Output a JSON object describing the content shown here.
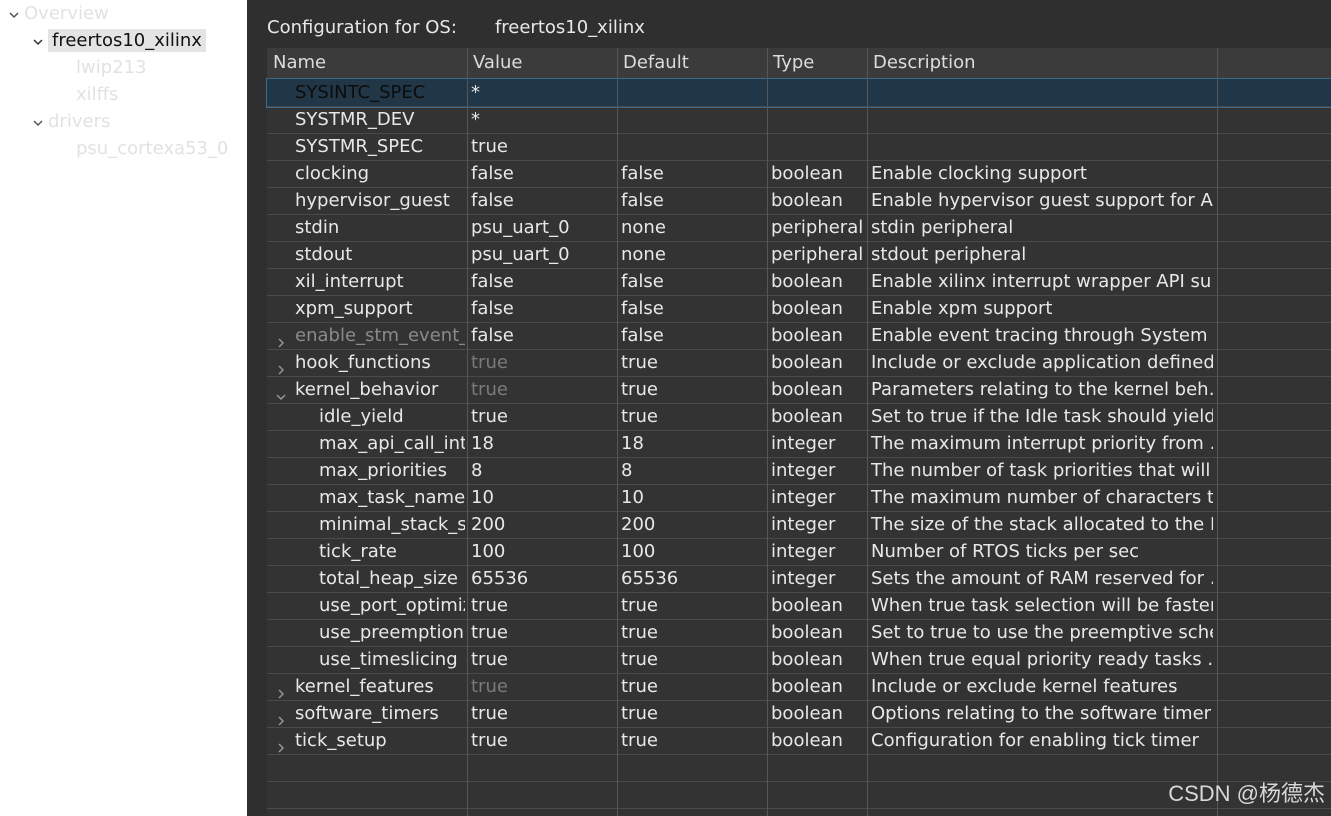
{
  "sidebar": {
    "items": [
      {
        "label": "Overview",
        "expanded": true
      },
      {
        "label": "freertos10_xilinx",
        "expanded": true,
        "selected": true
      },
      {
        "label": "lwip213"
      },
      {
        "label": "xilffs"
      },
      {
        "label": "drivers",
        "expanded": true
      },
      {
        "label": "psu_cortexa53_0"
      }
    ]
  },
  "header": {
    "label": "Configuration for OS:",
    "os_name": "freertos10_xilinx"
  },
  "table": {
    "columns": [
      "Name",
      "Value",
      "Default",
      "Type",
      "Description"
    ],
    "rows": [
      {
        "name": "SYSINTC_SPEC",
        "value": "*",
        "default": "",
        "type": "",
        "desc": "",
        "level": 0,
        "selected": true
      },
      {
        "name": "SYSTMR_DEV",
        "value": "*",
        "default": "",
        "type": "",
        "desc": "",
        "level": 0
      },
      {
        "name": "SYSTMR_SPEC",
        "value": "true",
        "default": "",
        "type": "",
        "desc": "",
        "level": 0
      },
      {
        "name": "clocking",
        "value": "false",
        "default": "false",
        "type": "boolean",
        "desc": "Enable clocking support",
        "level": 0
      },
      {
        "name": "hypervisor_guest",
        "value": "false",
        "default": "false",
        "type": "boolean",
        "desc": "Enable hypervisor guest support for A…",
        "level": 0
      },
      {
        "name": "stdin",
        "value": "psu_uart_0",
        "default": "none",
        "type": "peripheral",
        "desc": "stdin peripheral",
        "level": 0
      },
      {
        "name": "stdout",
        "value": "psu_uart_0",
        "default": "none",
        "type": "peripheral",
        "desc": "stdout peripheral",
        "level": 0
      },
      {
        "name": "xil_interrupt",
        "value": "false",
        "default": "false",
        "type": "boolean",
        "desc": "Enable xilinx interrupt wrapper API su…",
        "level": 0
      },
      {
        "name": "xpm_support",
        "value": "false",
        "default": "false",
        "type": "boolean",
        "desc": "Enable xpm support",
        "level": 0
      },
      {
        "name": "enable_stm_event_t",
        "value": "false",
        "default": "false",
        "type": "boolean",
        "desc": "Enable event tracing through System …",
        "level": 0,
        "expander": "collapsed",
        "name_dim": true
      },
      {
        "name": "hook_functions",
        "value": "true",
        "default": "true",
        "type": "boolean",
        "desc": "Include or exclude application defined…",
        "level": 0,
        "expander": "collapsed",
        "value_dim": true
      },
      {
        "name": "kernel_behavior",
        "value": "true",
        "default": "true",
        "type": "boolean",
        "desc": "Parameters relating to the kernel beh…",
        "level": 0,
        "expander": "expanded",
        "value_dim": true
      },
      {
        "name": "idle_yield",
        "value": "true",
        "default": "true",
        "type": "boolean",
        "desc": "Set to true if the Idle task should yield…",
        "level": 1
      },
      {
        "name": "max_api_call_inte",
        "value": "18",
        "default": "18",
        "type": "integer",
        "desc": "The maximum interrupt priority from …",
        "level": 1
      },
      {
        "name": "max_priorities",
        "value": "8",
        "default": "8",
        "type": "integer",
        "desc": "The number of task priorities that will …",
        "level": 1
      },
      {
        "name": "max_task_name_l",
        "value": "10",
        "default": "10",
        "type": "integer",
        "desc": "The maximum number of characters t…",
        "level": 1
      },
      {
        "name": "minimal_stack_siz",
        "value": "200",
        "default": "200",
        "type": "integer",
        "desc": "The size of the stack allocated to the I…",
        "level": 1
      },
      {
        "name": "tick_rate",
        "value": "100",
        "default": "100",
        "type": "integer",
        "desc": "Number of RTOS ticks per sec",
        "level": 1
      },
      {
        "name": "total_heap_size",
        "value": "65536",
        "default": "65536",
        "type": "integer",
        "desc": "Sets the amount of RAM reserved for …",
        "level": 1
      },
      {
        "name": "use_port_optimiz",
        "value": "true",
        "default": "true",
        "type": "boolean",
        "desc": "When true task selection will be faster …",
        "level": 1
      },
      {
        "name": "use_preemption",
        "value": "true",
        "default": "true",
        "type": "boolean",
        "desc": "Set to true to use the preemptive sche…",
        "level": 1
      },
      {
        "name": "use_timeslicing",
        "value": "true",
        "default": "true",
        "type": "boolean",
        "desc": "When true equal priority ready tasks …",
        "level": 1
      },
      {
        "name": "kernel_features",
        "value": "true",
        "default": "true",
        "type": "boolean",
        "desc": "Include or exclude kernel features",
        "level": 0,
        "expander": "collapsed",
        "value_dim": true
      },
      {
        "name": "software_timers",
        "value": "true",
        "default": "true",
        "type": "boolean",
        "desc": "Options relating to the software timer…",
        "level": 0,
        "expander": "collapsed"
      },
      {
        "name": "tick_setup",
        "value": "true",
        "default": "true",
        "type": "boolean",
        "desc": "Configuration for enabling tick timer",
        "level": 0,
        "expander": "collapsed"
      }
    ]
  },
  "watermark": "CSDN @杨德杰",
  "colors": {
    "panel_bg": "#2f2f2f",
    "selected_row": "#213747",
    "sidebar_bg": "#ffffff"
  }
}
